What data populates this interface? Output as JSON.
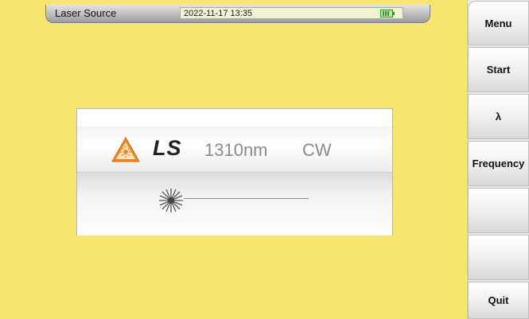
{
  "statusbar": {
    "app_title": "Laser Source",
    "datetime": "2022-11-17 13:35",
    "battery_icon": "battery-icon"
  },
  "softkeys": [
    {
      "label": "Menu"
    },
    {
      "label": "Start"
    },
    {
      "label": "λ"
    },
    {
      "label": "Frequency"
    },
    {
      "label": ""
    },
    {
      "label": ""
    },
    {
      "label": "Quit"
    }
  ],
  "panel": {
    "source_label": "LS",
    "wavelength": "1310nm",
    "mode": "CW",
    "warning_icon": "laser-warning-icon",
    "emission_icon": "laser-beam-icon"
  },
  "colors": {
    "background": "#f6e66f",
    "warning_orange": "#f08a1c"
  }
}
